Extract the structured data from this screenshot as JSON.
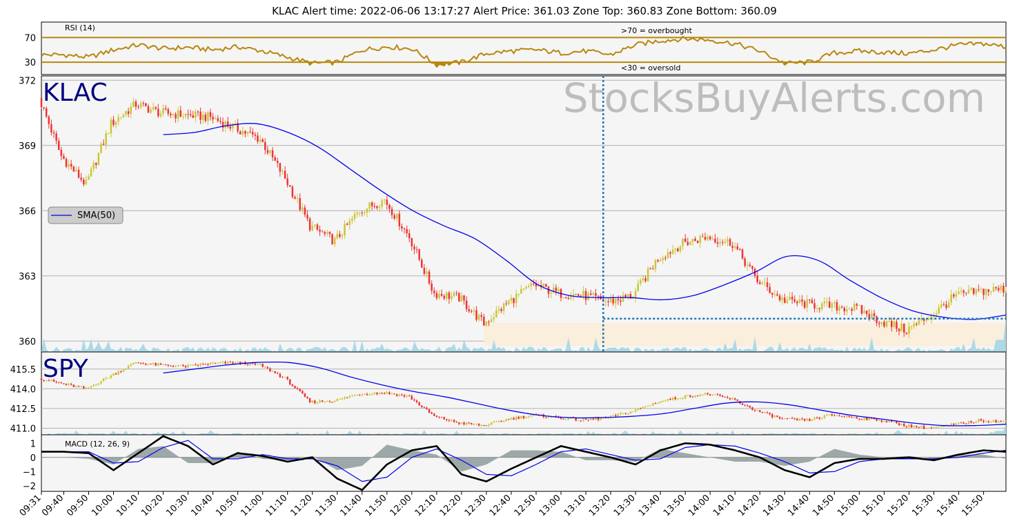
{
  "title": "KLAC   Alert time: 2022-06-06 13:17:27          Alert Price: 361.03        Zone Top: 360.83  Zone Bottom: 360.09",
  "watermark": "StocksBuyAlerts.com",
  "colors": {
    "panel_bg": "#f5f5f5",
    "rsi_line": "#b8860b",
    "up_candle": "#c8c832",
    "down_candle": "#ee3333",
    "sma": "#0000ee",
    "volume": "#add8e6",
    "zone": "#faeedc",
    "alert_line": "#1f77b4",
    "macd_line": "#000000",
    "macd_signal": "#0000ee",
    "macd_hist": "#7f8f8f",
    "ticker_text": "#000080"
  },
  "chart_data": [
    {
      "type": "line",
      "panel": "rsi",
      "label": "RSI (14)",
      "annotations": [
        ">70 = overbought",
        "<30 = oversold"
      ],
      "yticks": [
        "70",
        "30"
      ],
      "ylim": [
        10,
        95
      ],
      "thresholds": [
        70,
        30
      ],
      "x": [
        "09:31",
        "09:40",
        "09:50",
        "10:00",
        "10:10",
        "10:20",
        "10:30",
        "10:40",
        "10:50",
        "11:00",
        "11:10",
        "11:20",
        "11:30",
        "11:40",
        "11:50",
        "12:00",
        "12:10",
        "12:20",
        "12:30",
        "12:40",
        "12:50",
        "13:00",
        "13:10",
        "13:20",
        "13:30",
        "13:40",
        "13:50",
        "14:00",
        "14:10",
        "14:20",
        "14:30",
        "14:40",
        "14:50",
        "15:00",
        "15:10",
        "15:20",
        "15:30",
        "15:40",
        "15:50",
        "15:59"
      ],
      "values": [
        42,
        42,
        38,
        50,
        58,
        52,
        54,
        50,
        55,
        48,
        38,
        28,
        30,
        50,
        55,
        52,
        26,
        30,
        44,
        48,
        50,
        45,
        48,
        42,
        58,
        65,
        68,
        66,
        60,
        48,
        28,
        30,
        45,
        48,
        46,
        44,
        50,
        58,
        60,
        55
      ]
    },
    {
      "type": "candlestick",
      "panel": "price",
      "ticker": "KLAC",
      "yticks": [
        "372",
        "369",
        "366",
        "363",
        "360"
      ],
      "ylim": [
        359.5,
        372.2
      ],
      "x": [
        "09:31",
        "09:40",
        "09:50",
        "10:00",
        "10:10",
        "10:20",
        "10:30",
        "10:40",
        "10:50",
        "11:00",
        "11:10",
        "11:20",
        "11:30",
        "11:40",
        "11:50",
        "12:00",
        "12:10",
        "12:20",
        "12:30",
        "12:40",
        "12:50",
        "13:00",
        "13:10",
        "13:20",
        "13:30",
        "13:40",
        "13:50",
        "14:00",
        "14:10",
        "14:20",
        "14:30",
        "14:40",
        "14:50",
        "15:00",
        "15:10",
        "15:20",
        "15:30",
        "15:40",
        "15:50",
        "15:59"
      ],
      "close": [
        371.2,
        368.5,
        367.2,
        370.0,
        370.9,
        370.5,
        370.4,
        370.3,
        369.8,
        369.3,
        367.5,
        365.3,
        364.6,
        366.0,
        366.5,
        364.8,
        362.2,
        362.0,
        360.8,
        361.8,
        362.6,
        362.2,
        362.1,
        361.8,
        362.1,
        363.8,
        364.5,
        364.8,
        364.5,
        362.8,
        361.9,
        361.7,
        361.6,
        361.5,
        360.9,
        360.5,
        361.2,
        362.1,
        362.3,
        362.4
      ],
      "sma": {
        "name": "SMA(50)",
        "start": "10:20",
        "values": [
          369.5,
          369.6,
          369.9,
          370.0,
          369.6,
          368.9,
          367.9,
          366.9,
          366.0,
          365.3,
          364.7,
          363.7,
          362.6,
          362.1,
          362.0,
          362.0,
          361.9,
          362.1,
          362.6,
          363.2,
          363.9,
          363.7,
          362.8,
          362.0,
          361.4,
          361.1,
          361.0,
          361.2
        ]
      },
      "alert_time": "13:17",
      "alert_price": 361.03,
      "zone_top": 360.83,
      "zone_bottom": 360.09,
      "zone_start": "12:29"
    },
    {
      "type": "candlestick",
      "panel": "spy",
      "ticker": "SPY",
      "yticks": [
        "415.5",
        "414.0",
        "412.5",
        "411.0"
      ],
      "ylim": [
        410.5,
        416.8
      ],
      "x": [
        "09:31",
        "09:40",
        "09:50",
        "10:00",
        "10:10",
        "10:20",
        "10:30",
        "10:40",
        "10:50",
        "11:00",
        "11:10",
        "11:20",
        "11:30",
        "11:40",
        "11:50",
        "12:00",
        "12:10",
        "12:20",
        "12:30",
        "12:40",
        "12:50",
        "13:00",
        "13:10",
        "13:20",
        "13:30",
        "13:40",
        "13:50",
        "14:00",
        "14:10",
        "14:20",
        "14:30",
        "14:40",
        "14:50",
        "15:00",
        "15:10",
        "15:20",
        "15:30",
        "15:40",
        "15:50",
        "15:59"
      ],
      "close": [
        414.8,
        414.4,
        414.0,
        415.0,
        416.0,
        415.8,
        415.7,
        415.9,
        416.0,
        415.8,
        414.8,
        413.0,
        413.1,
        413.6,
        413.7,
        413.4,
        411.9,
        411.4,
        411.2,
        411.7,
        412.0,
        411.8,
        411.6,
        411.8,
        412.3,
        413.0,
        413.4,
        413.6,
        413.2,
        412.3,
        411.7,
        411.6,
        412.0,
        411.8,
        411.6,
        411.2,
        411.0,
        411.3,
        411.6,
        411.5
      ],
      "sma": {
        "name": "",
        "start": "10:20",
        "values": [
          415.2,
          415.5,
          415.8,
          416.0,
          416.0,
          415.6,
          414.9,
          414.3,
          413.8,
          413.4,
          412.9,
          412.4,
          412.0,
          411.8,
          411.8,
          411.9,
          412.1,
          412.5,
          412.9,
          413.0,
          412.8,
          412.4,
          412.0,
          411.7,
          411.4,
          411.2,
          411.2,
          411.3
        ]
      }
    },
    {
      "type": "line",
      "panel": "macd",
      "label": "MACD (12, 26, 9)",
      "yticks": [
        "1",
        "0",
        "−1",
        "−2"
      ],
      "ylim": [
        -2.4,
        1.6
      ],
      "x": [
        "09:31",
        "09:40",
        "09:50",
        "10:00",
        "10:10",
        "10:20",
        "10:30",
        "10:40",
        "10:50",
        "11:00",
        "11:10",
        "11:20",
        "11:30",
        "11:40",
        "11:50",
        "12:00",
        "12:10",
        "12:20",
        "12:30",
        "12:40",
        "12:50",
        "13:00",
        "13:10",
        "13:20",
        "13:30",
        "13:40",
        "13:50",
        "14:00",
        "14:10",
        "14:20",
        "14:30",
        "14:40",
        "14:50",
        "15:00",
        "15:10",
        "15:20",
        "15:30",
        "15:40",
        "15:50",
        "15:59"
      ],
      "macd": [
        0.4,
        0.4,
        0.3,
        -0.9,
        0.3,
        1.5,
        0.8,
        -0.5,
        0.3,
        0.1,
        -0.3,
        0.0,
        -1.5,
        -2.3,
        -0.5,
        0.5,
        0.8,
        -1.2,
        -1.7,
        -0.8,
        0.0,
        0.8,
        0.4,
        0.0,
        -0.5,
        0.5,
        1.0,
        0.9,
        0.5,
        0.0,
        -0.9,
        -1.4,
        -0.4,
        -0.1,
        -0.1,
        0.0,
        -0.2,
        0.2,
        0.5,
        0.4
      ],
      "signal": [
        0.4,
        0.4,
        0.4,
        -0.4,
        -0.3,
        0.7,
        1.2,
        -0.1,
        -0.1,
        0.2,
        -0.1,
        -0.1,
        -0.6,
        -1.7,
        -1.4,
        0.0,
        0.6,
        -0.2,
        -1.2,
        -1.3,
        -0.5,
        0.4,
        0.6,
        0.2,
        -0.2,
        -0.1,
        0.7,
        0.9,
        0.8,
        0.3,
        -0.3,
        -1.1,
        -1.0,
        -0.3,
        -0.1,
        -0.1,
        -0.1,
        0.0,
        0.3,
        0.5
      ]
    }
  ],
  "x_tick_labels": [
    "09:31",
    "09:40",
    "09:50",
    "10:00",
    "10:10",
    "10:20",
    "10:30",
    "10:40",
    "10:50",
    "11:00",
    "11:10",
    "11:20",
    "11:30",
    "11:40",
    "11:50",
    "12:00",
    "12:10",
    "12:20",
    "12:30",
    "12:40",
    "12:50",
    "13:00",
    "13:10",
    "13:20",
    "13:30",
    "13:40",
    "13:50",
    "14:00",
    "14:10",
    "14:20",
    "14:30",
    "14:40",
    "14:50",
    "15:00",
    "15:10",
    "15:20",
    "15:30",
    "15:40",
    "15:50"
  ]
}
